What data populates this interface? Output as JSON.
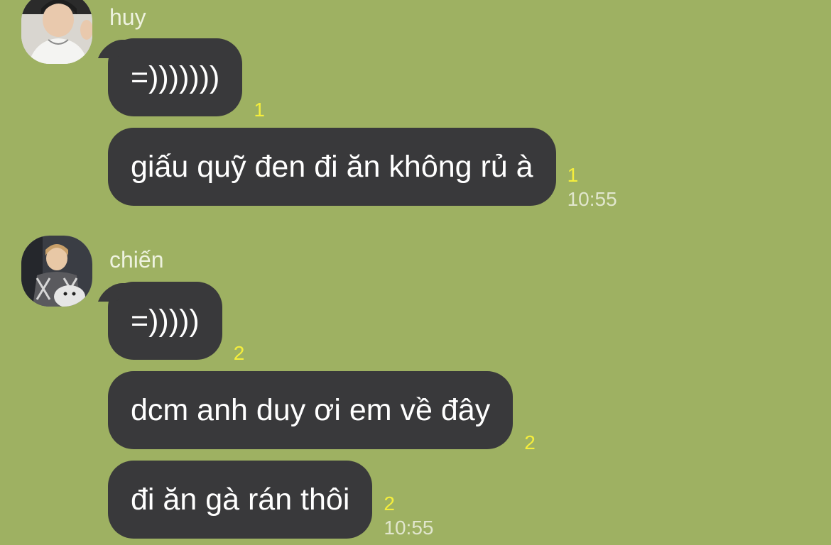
{
  "conversation": {
    "groups": [
      {
        "sender": "huy",
        "messages": [
          {
            "text": "=)))))))",
            "read_count": "1",
            "time": ""
          },
          {
            "text": "giấu quỹ đen đi ăn không rủ à",
            "read_count": "1",
            "time": "10:55"
          }
        ]
      },
      {
        "sender": "chiến",
        "messages": [
          {
            "text": "=)))))",
            "read_count": "2",
            "time": ""
          },
          {
            "text": "dcm anh duy ơi em về đây",
            "read_count": "2",
            "time": ""
          },
          {
            "text": "đi ăn gà rán thôi",
            "read_count": "2",
            "time": "10:55"
          }
        ]
      }
    ]
  },
  "colors": {
    "background": "#9eb162",
    "bubble": "#39393b",
    "read_count": "#f5ee3c",
    "timestamp": "#e1e6cd"
  }
}
